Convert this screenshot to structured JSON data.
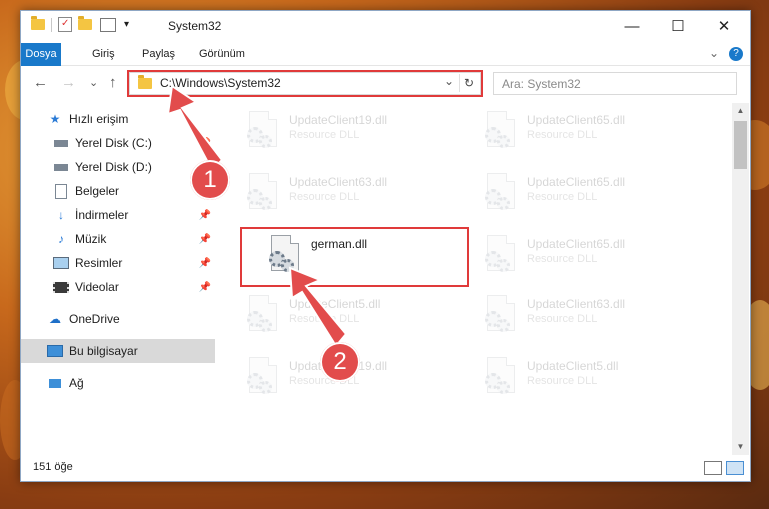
{
  "titlebar": {
    "title": "System32",
    "minimize": "—",
    "maximize": "☐",
    "close": "✕",
    "dropdown": "▾"
  },
  "ribbon": {
    "tabs": [
      "Dosya",
      "Giriş",
      "Paylaş",
      "Görünüm"
    ],
    "help": "?",
    "expand": "⌄"
  },
  "navbar": {
    "back": "←",
    "forward": "→",
    "recent": "⌄",
    "up": "↑",
    "address": "C:\\Windows\\System32",
    "address_dropdown": "⌄",
    "refresh": "↻",
    "search_placeholder": "Ara: System32"
  },
  "sidebar": {
    "items": [
      {
        "label": "Hızlı erişim",
        "icon": "star-icon"
      },
      {
        "label": "Yerel Disk (C:)",
        "icon": "drive-icon",
        "pinned": true
      },
      {
        "label": "Yerel Disk (D:)",
        "icon": "drive-icon",
        "pinned": false
      },
      {
        "label": "Belgeler",
        "icon": "documents-icon",
        "pinned": true
      },
      {
        "label": "İndirmeler",
        "icon": "download-icon",
        "pinned": true
      },
      {
        "label": "Müzik",
        "icon": "music-icon",
        "pinned": true
      },
      {
        "label": "Resimler",
        "icon": "pictures-icon",
        "pinned": true
      },
      {
        "label": "Videolar",
        "icon": "videos-icon",
        "pinned": true
      },
      {
        "label": "OneDrive",
        "icon": "cloud-icon"
      },
      {
        "label": "Bu bilgisayar",
        "icon": "computer-icon",
        "selected": true
      },
      {
        "label": "Ağ",
        "icon": "network-icon"
      }
    ],
    "pin_glyph": "📌"
  },
  "files": [
    {
      "name": "UpdateClient19.dll",
      "desc": "Resource DLL",
      "faded": true
    },
    {
      "name": "UpdateClient65.dll",
      "desc": "Resource DLL",
      "faded": true
    },
    {
      "name": "UpdateClient63.dll",
      "desc": "Resource DLL",
      "faded": true
    },
    {
      "name": "UpdateClient65.dll",
      "desc": "Resource DLL",
      "faded": true
    },
    {
      "name": "german.dll",
      "desc": "",
      "faded": false
    },
    {
      "name": "UpdateClient65.dll",
      "desc": "Resource DLL",
      "faded": true
    },
    {
      "name": "UpdateClient5.dll",
      "desc": "Resource DLL",
      "faded": true
    },
    {
      "name": "UpdateClient63.dll",
      "desc": "Resource DLL",
      "faded": true
    },
    {
      "name": "UpdateClient19.dll",
      "desc": "Resource DLL",
      "faded": true
    },
    {
      "name": "UpdateClient5.dll",
      "desc": "Resource DLL",
      "faded": true
    }
  ],
  "status": {
    "count": "151 öğe"
  },
  "annotations": {
    "step1": "1",
    "step2": "2"
  },
  "colors": {
    "accent": "#1979ca",
    "annotation": "#e03a3a"
  }
}
